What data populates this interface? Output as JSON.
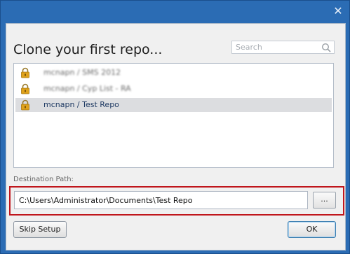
{
  "window": {
    "close_glyph": "✕"
  },
  "dialog": {
    "heading": "Clone your first repo...",
    "search": {
      "placeholder": "Search",
      "icon": "search-icon"
    },
    "repos": [
      {
        "label": "mcnapn / SMS 2012",
        "locked": true,
        "obscured": true,
        "selected": false
      },
      {
        "label": "mcnapn / Cyp List - RA",
        "locked": true,
        "obscured": true,
        "selected": false
      },
      {
        "label": "mcnapn / Test Repo",
        "locked": true,
        "obscured": false,
        "selected": true
      }
    ],
    "destination": {
      "label": "Destination Path:",
      "value": "C:\\Users\\Administrator\\Documents\\Test Repo",
      "browse_label": "..."
    },
    "buttons": {
      "skip": "Skip Setup",
      "ok": "OK"
    }
  },
  "colors": {
    "title_bar": "#2b6cb4",
    "highlight_border": "#c0161c",
    "selected_row": "#dcdde0",
    "lock_icon": "#e0a21b"
  }
}
